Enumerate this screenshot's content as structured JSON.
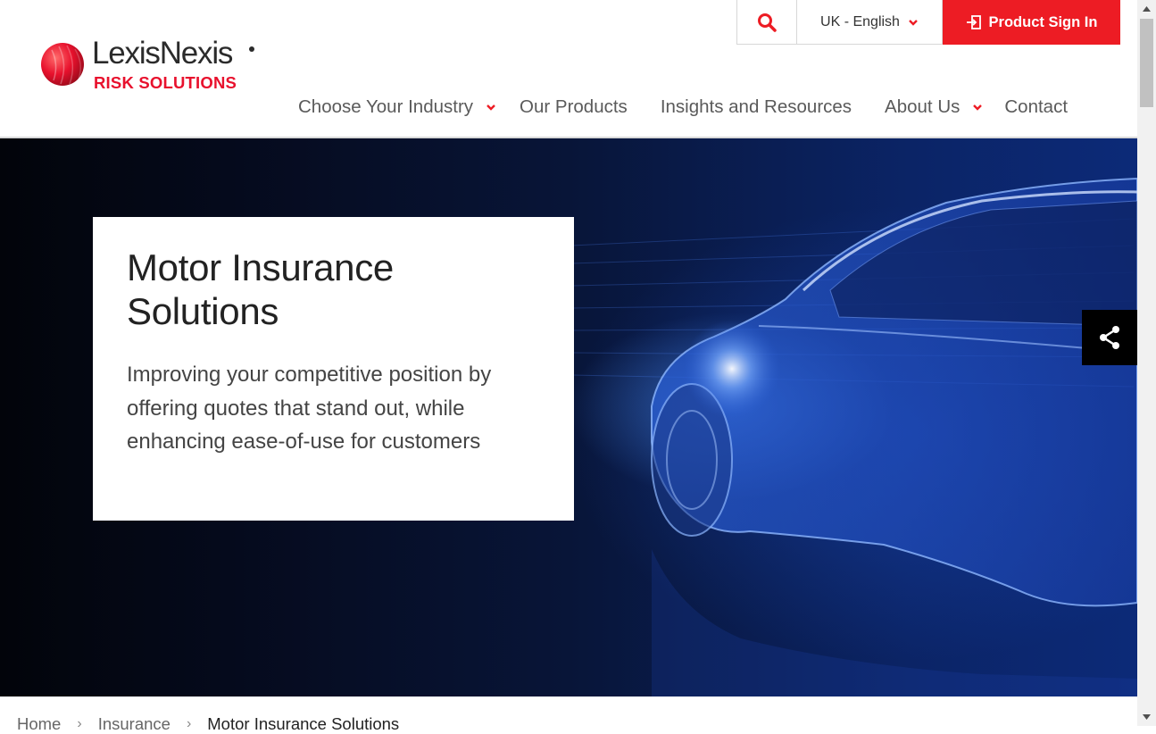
{
  "brand": {
    "name": "LexisNexis",
    "division": "RISK SOLUTIONS",
    "red": "#ed1c24"
  },
  "utility": {
    "search_icon": "search-icon",
    "language": "UK - English",
    "sign_in": "Product Sign In"
  },
  "nav": {
    "items": [
      {
        "label": "Choose Your Industry",
        "has_dropdown": true
      },
      {
        "label": "Our Products",
        "has_dropdown": false
      },
      {
        "label": "Insights and Resources",
        "has_dropdown": false
      },
      {
        "label": "About Us",
        "has_dropdown": true
      },
      {
        "label": "Contact",
        "has_dropdown": false
      }
    ]
  },
  "hero": {
    "title": "Motor Insurance Solutions",
    "description": "Improving your competitive position by offering quotes that stand out, while enhancing ease-of-use for customers",
    "share_icon": "share-icon"
  },
  "breadcrumb": {
    "items": [
      "Home",
      "Insurance",
      "Motor Insurance Solutions"
    ]
  }
}
